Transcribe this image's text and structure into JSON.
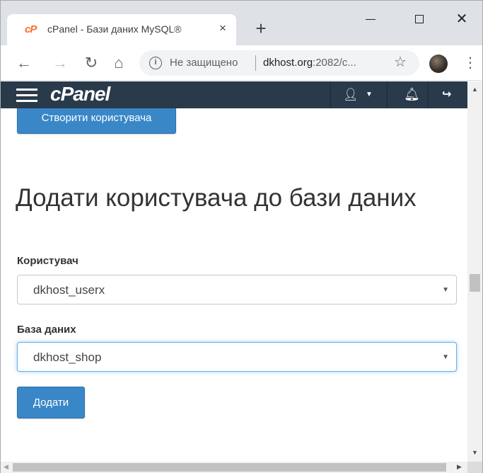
{
  "browser": {
    "tab": {
      "favicon_text": "cP",
      "title": "cPanel - Бази даних MySQL®",
      "close_glyph": "×"
    },
    "new_tab_glyph": "+",
    "omnibox": {
      "security_status": "Не защищено",
      "url_host": "dkhost.org",
      "url_rest": ":2082/c..."
    }
  },
  "cpanel": {
    "logo": "cPanel"
  },
  "page": {
    "create_user_button": "Створити користувача",
    "heading": "Додати користувача до бази даних",
    "user_label": "Користувач",
    "user_value": "dkhost_userx",
    "db_label": "База даних",
    "db_value": "dkhost_shop",
    "add_button": "Додати"
  },
  "colors": {
    "header_bg": "#293a4a",
    "button_primary": "#3a87c8",
    "focus_border": "#66afe9",
    "favicon": "#ff6c2c"
  },
  "icons": [
    "cpanel-favicon-icon",
    "close-icon",
    "plus-icon",
    "minimize-icon",
    "maximize-icon",
    "back-icon",
    "forward-icon",
    "reload-icon",
    "home-icon",
    "info-icon",
    "star-icon",
    "profile-avatar",
    "kebab-menu-icon",
    "hamburger-icon",
    "user-icon",
    "caret-down-icon",
    "bell-icon",
    "logout-icon"
  ]
}
